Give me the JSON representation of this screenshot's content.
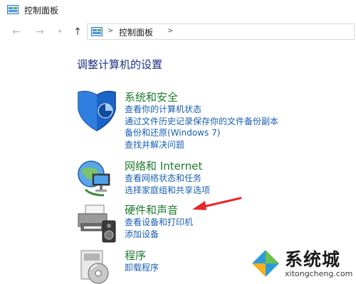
{
  "window": {
    "title": "控制面板",
    "icon": "control-panel-icon"
  },
  "nav": {
    "back_icon": "back-arrow-icon",
    "forward_icon": "forward-arrow-icon",
    "recent_icon": "chevron-down-icon",
    "up_icon": "up-arrow-icon",
    "address_separator": ">",
    "breadcrumb": "控制面板"
  },
  "main": {
    "heading": "调整计算机的设置",
    "categories": [
      {
        "title": "系统和安全",
        "icon": "shield-icon",
        "links": [
          "查看你的计算机状态",
          "通过文件历史记录保存你的文件备份副本",
          "备份和还原(Windows 7)",
          "查找并解决问题"
        ]
      },
      {
        "title": "网络和 Internet",
        "icon": "network-globe-icon",
        "links": [
          "查看网络状态和任务",
          "选择家庭组和共享选项"
        ]
      },
      {
        "title": "硬件和声音",
        "icon": "printer-speaker-icon",
        "links": [
          "查看设备和打印机",
          "添加设备"
        ]
      },
      {
        "title": "程序",
        "icon": "programs-disc-icon",
        "links": [
          "卸载程序"
        ]
      }
    ]
  },
  "annotation": {
    "arrow_color": "#e8262a"
  },
  "watermark": {
    "text": "系统城",
    "url": "xitongcheng.com"
  },
  "colors": {
    "link": "#1a5fb4",
    "category_title": "#1c7a2e",
    "heading": "#1e3287"
  }
}
